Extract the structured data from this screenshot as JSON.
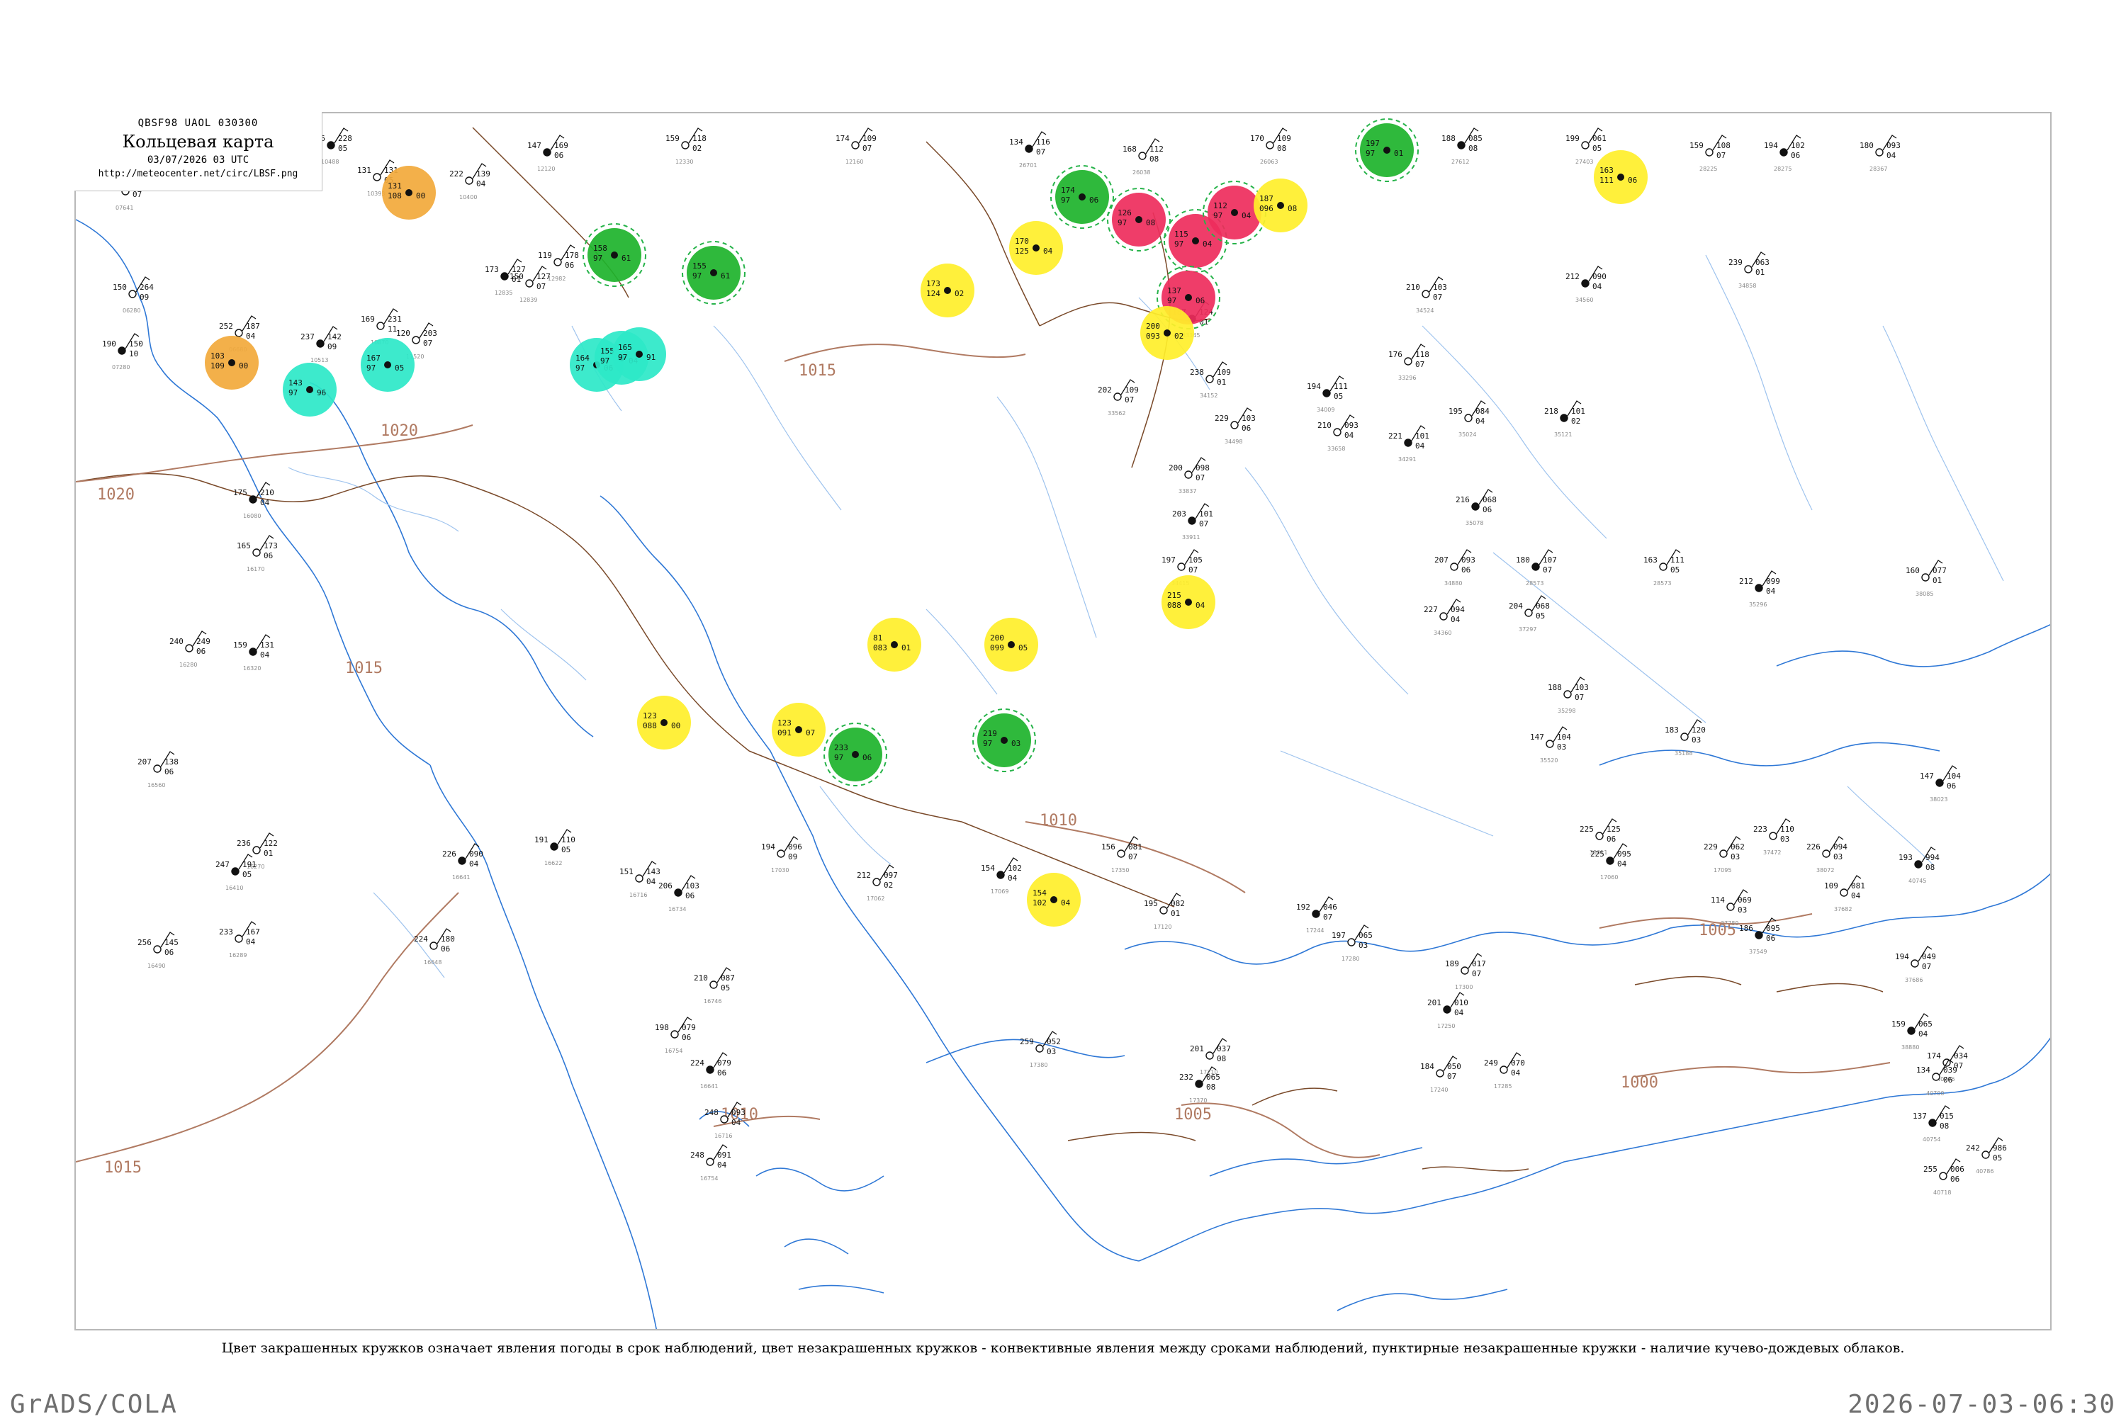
{
  "header": {
    "code": "QBSF98  UAOL  030300",
    "title": "Кольцевая карта",
    "time": "03/07/2026 03 UTC",
    "url": "http://meteocenter.net/circ/LBSF.png"
  },
  "caption": "Цвет закрашенных кружков означает явления погоды в срок наблюдений, цвет незакрашенных кружков - конвективные явления между сроками наблюдений, пунктирные незакрашенные кружки - наличие кучево-дождевых облаков.",
  "footer": {
    "left": "GrADS/COLA",
    "right": "2026-07-03-06:30"
  },
  "isobar_labels": [
    "1020",
    "1015",
    "1015",
    "1010",
    "1005",
    "1020",
    "1015",
    "1010",
    "1005",
    "1000"
  ],
  "colors": {
    "coast": "#2f78d6",
    "river": "#9ec3ee",
    "border": "#7a4a2a",
    "isobar": "#b07a62",
    "thunderstorm_green": "#1db32b",
    "rain_cyan": "#2de8c8",
    "shower_yellow": "#ffef2a",
    "heavy_red": "#ee2c5c",
    "drizzle_orange": "#f2a93b",
    "outline_green": "#27b34a"
  },
  "stations": [
    {
      "t": "126",
      "p": "228",
      "d": "05",
      "id": "10488"
    },
    {
      "t": "131",
      "p": "131",
      "d": "05",
      "id": "10393"
    },
    {
      "t": "222",
      "p": "139",
      "d": "04",
      "id": "10400"
    },
    {
      "t": "147",
      "p": "169",
      "d": "06",
      "id": "12120"
    },
    {
      "t": "159",
      "p": "118",
      "d": "02",
      "id": "12330"
    },
    {
      "t": "174",
      "p": "109",
      "d": "07",
      "id": "12160"
    },
    {
      "t": "134",
      "p": "116",
      "d": "07",
      "id": "26701"
    },
    {
      "t": "168",
      "p": "112",
      "d": "08",
      "id": "26038"
    },
    {
      "t": "170",
      "p": "109",
      "d": "08",
      "id": "26063"
    },
    {
      "t": "188",
      "p": "085",
      "d": "08",
      "id": "27612"
    },
    {
      "t": "199",
      "p": "061",
      "d": "05",
      "id": "27403"
    },
    {
      "t": "159",
      "p": "108",
      "d": "07",
      "id": "28225"
    },
    {
      "t": "194",
      "p": "102",
      "d": "06",
      "id": "28275"
    },
    {
      "t": "180",
      "p": "093",
      "d": "04",
      "id": "28367"
    },
    {
      "t": "273",
      "p": "178",
      "d": "07",
      "id": "07641"
    },
    {
      "t": "190",
      "p": "150",
      "d": "10",
      "id": "07280"
    },
    {
      "t": "150",
      "p": "264",
      "d": "09",
      "id": "06280"
    },
    {
      "t": "252",
      "p": "187",
      "d": "04",
      "id": "06680"
    },
    {
      "t": "237",
      "p": "142",
      "d": "09",
      "id": "10513"
    },
    {
      "t": "169",
      "p": "231",
      "d": "11",
      "id": "10870"
    },
    {
      "t": "120",
      "p": "203",
      "d": "07",
      "id": "11520"
    },
    {
      "t": "173",
      "p": "127",
      "d": "01",
      "id": "12835"
    },
    {
      "t": "119",
      "p": "178",
      "d": "06",
      "id": "12982"
    },
    {
      "t": "150",
      "p": "127",
      "d": "07",
      "id": "12839"
    },
    {
      "t": "175",
      "p": "210",
      "d": "04",
      "id": "16080"
    },
    {
      "t": "165",
      "p": "173",
      "d": "06",
      "id": "16170"
    },
    {
      "t": "240",
      "p": "249",
      "d": "06",
      "id": "16280"
    },
    {
      "t": "159",
      "p": "131",
      "d": "04",
      "id": "16320"
    },
    {
      "t": "207",
      "p": "138",
      "d": "06",
      "id": "16560"
    },
    {
      "t": "236",
      "p": "122",
      "d": "01",
      "id": "16270"
    },
    {
      "t": "247",
      "p": "191",
      "d": "05",
      "id": "16410"
    },
    {
      "t": "233",
      "p": "167",
      "d": "04",
      "id": "16289"
    },
    {
      "t": "256",
      "p": "145",
      "d": "06",
      "id": "16490"
    },
    {
      "t": "226",
      "p": "090",
      "d": "04",
      "id": "16641"
    },
    {
      "t": "224",
      "p": "180",
      "d": "06",
      "id": "16648"
    },
    {
      "t": "151",
      "p": "143",
      "d": "04",
      "id": "16716"
    },
    {
      "t": "206",
      "p": "103",
      "d": "06",
      "id": "16734"
    },
    {
      "t": "210",
      "p": "087",
      "d": "05",
      "id": "16746"
    },
    {
      "t": "198",
      "p": "079",
      "d": "06",
      "id": "16754"
    },
    {
      "t": "224",
      "p": "079",
      "d": "06",
      "id": "16641"
    },
    {
      "t": "248",
      "p": "093",
      "d": "04",
      "id": "16716"
    },
    {
      "t": "248",
      "p": "091",
      "d": "04",
      "id": "16754"
    },
    {
      "t": "191",
      "p": "110",
      "d": "05",
      "id": "16622"
    },
    {
      "t": "194",
      "p": "096",
      "d": "09",
      "id": "17030"
    },
    {
      "t": "212",
      "p": "097",
      "d": "02",
      "id": "17062"
    },
    {
      "t": "154",
      "p": "102",
      "d": "04",
      "id": "17069"
    },
    {
      "t": "156",
      "p": "081",
      "d": "07",
      "id": "17350"
    },
    {
      "t": "195",
      "p": "082",
      "d": "01",
      "id": "17120"
    },
    {
      "t": "192",
      "p": "046",
      "d": "07",
      "id": "17244"
    },
    {
      "t": "197",
      "p": "065",
      "d": "03",
      "id": "17280"
    },
    {
      "t": "189",
      "p": "017",
      "d": "07",
      "id": "17300"
    },
    {
      "t": "201",
      "p": "010",
      "d": "04",
      "id": "17250"
    },
    {
      "t": "184",
      "p": "050",
      "d": "07",
      "id": "17240"
    },
    {
      "t": "259",
      "p": "052",
      "d": "03",
      "id": "17380"
    },
    {
      "t": "232",
      "p": "065",
      "d": "08",
      "id": "17370"
    },
    {
      "t": "201",
      "p": "037",
      "d": "08",
      "id": "17210"
    },
    {
      "t": "249",
      "p": "070",
      "d": "04",
      "id": "17285"
    },
    {
      "t": "225",
      "p": "095",
      "d": "04",
      "id": "17060"
    },
    {
      "t": "229",
      "p": "062",
      "d": "03",
      "id": "17095"
    },
    {
      "t": "114",
      "p": "069",
      "d": "03",
      "id": "37789"
    },
    {
      "t": "186",
      "p": "095",
      "d": "06",
      "id": "37549"
    },
    {
      "t": "109",
      "p": "081",
      "d": "04",
      "id": "37682"
    },
    {
      "t": "194",
      "p": "049",
      "d": "07",
      "id": "37686"
    },
    {
      "t": "159",
      "p": "065",
      "d": "04",
      "id": "38880"
    },
    {
      "t": "174",
      "p": "034",
      "d": "07",
      "id": "40706"
    },
    {
      "t": "134",
      "p": "039",
      "d": "06",
      "id": "40700"
    },
    {
      "t": "137",
      "p": "015",
      "d": "08",
      "id": "40754"
    },
    {
      "t": "255",
      "p": "006",
      "d": "06",
      "id": "40718"
    },
    {
      "t": "242",
      "p": "986",
      "d": "05",
      "id": "40786"
    },
    {
      "t": "193",
      "p": "994",
      "d": "08",
      "id": "40745"
    },
    {
      "t": "223",
      "p": "110",
      "d": "03",
      "id": "37472"
    },
    {
      "t": "226",
      "p": "094",
      "d": "03",
      "id": "38072"
    },
    {
      "t": "147",
      "p": "104",
      "d": "06",
      "id": "38023"
    },
    {
      "t": "160",
      "p": "077",
      "d": "01",
      "id": "38085"
    },
    {
      "t": "204",
      "p": "068",
      "d": "05",
      "id": "37297"
    },
    {
      "t": "216",
      "p": "068",
      "d": "06",
      "id": "35078"
    },
    {
      "t": "207",
      "p": "093",
      "d": "06",
      "id": "34880"
    },
    {
      "t": "227",
      "p": "094",
      "d": "04",
      "id": "34360"
    },
    {
      "t": "221",
      "p": "101",
      "d": "04",
      "id": "34291"
    },
    {
      "t": "229",
      "p": "103",
      "d": "06",
      "id": "34498"
    },
    {
      "t": "238",
      "p": "109",
      "d": "01",
      "id": "34152"
    },
    {
      "t": "194",
      "p": "111",
      "d": "05",
      "id": "34009"
    },
    {
      "t": "210",
      "p": "093",
      "d": "04",
      "id": "33658"
    },
    {
      "t": "200",
      "p": "098",
      "d": "07",
      "id": "33837"
    },
    {
      "t": "203",
      "p": "101",
      "d": "07",
      "id": "33911"
    },
    {
      "t": "197",
      "p": "105",
      "d": "07",
      "id": "34415"
    },
    {
      "t": "202",
      "p": "109",
      "d": "07",
      "id": "33562"
    },
    {
      "t": "187",
      "p": "124",
      "d": "01",
      "id": "33345"
    },
    {
      "t": "176",
      "p": "118",
      "d": "07",
      "id": "33296"
    },
    {
      "t": "210",
      "p": "103",
      "d": "07",
      "id": "34524"
    },
    {
      "t": "212",
      "p": "090",
      "d": "04",
      "id": "34560"
    },
    {
      "t": "239",
      "p": "063",
      "d": "01",
      "id": "34858"
    },
    {
      "t": "195",
      "p": "084",
      "d": "04",
      "id": "35024"
    },
    {
      "t": "218",
      "p": "101",
      "d": "02",
      "id": "35121"
    },
    {
      "t": "183",
      "p": "120",
      "d": "03",
      "id": "35188"
    },
    {
      "t": "188",
      "p": "103",
      "d": "07",
      "id": "35298"
    },
    {
      "t": "212",
      "p": "099",
      "d": "04",
      "id": "35296"
    },
    {
      "t": "147",
      "p": "104",
      "d": "03",
      "id": "35520"
    },
    {
      "t": "163",
      "p": "111",
      "d": "05",
      "id": "28573"
    },
    {
      "t": "180",
      "p": "107",
      "d": "07",
      "id": "28573"
    },
    {
      "t": "225",
      "p": "125",
      "d": "06",
      "id": "35011"
    }
  ],
  "weather_markers": [
    {
      "kind": "drizzle_orange",
      "t": "131",
      "p": "108",
      "d": "00"
    },
    {
      "kind": "drizzle_orange",
      "t": "103",
      "p": "109",
      "d": "00"
    },
    {
      "kind": "rain_cyan",
      "t": "143",
      "p": "97",
      "d": "96"
    },
    {
      "kind": "rain_cyan",
      "t": "167",
      "p": "97",
      "d": "05"
    },
    {
      "kind": "rain_cyan",
      "t": "164",
      "p": "97",
      "d": "06"
    },
    {
      "kind": "rain_cyan",
      "t": "155",
      "p": "97",
      "d": "04"
    },
    {
      "kind": "rain_cyan",
      "t": "165",
      "p": "97",
      "d": "91"
    },
    {
      "kind": "thunderstorm_green",
      "t": "158",
      "p": "97",
      "d": "61"
    },
    {
      "kind": "thunderstorm_green",
      "t": "155",
      "p": "97",
      "d": "61"
    },
    {
      "kind": "thunderstorm_green",
      "t": "174",
      "p": "97",
      "d": "06"
    },
    {
      "kind": "thunderstorm_green",
      "t": "197",
      "p": "97",
      "d": "01"
    },
    {
      "kind": "thunderstorm_green",
      "t": "233",
      "p": "97",
      "d": "06"
    },
    {
      "kind": "thunderstorm_green",
      "t": "219",
      "p": "97",
      "d": "03"
    },
    {
      "kind": "heavy_red",
      "t": "126",
      "p": "97",
      "d": "08"
    },
    {
      "kind": "heavy_red",
      "t": "115",
      "p": "97",
      "d": "04"
    },
    {
      "kind": "heavy_red",
      "t": "112",
      "p": "97",
      "d": "04"
    },
    {
      "kind": "heavy_red",
      "t": "137",
      "p": "97",
      "d": "06"
    },
    {
      "kind": "shower_yellow",
      "t": "170",
      "p": "125",
      "d": "04"
    },
    {
      "kind": "shower_yellow",
      "t": "173",
      "p": "124",
      "d": "02"
    },
    {
      "kind": "shower_yellow",
      "t": "200",
      "p": "093",
      "d": "02"
    },
    {
      "kind": "shower_yellow",
      "t": "187",
      "p": "096",
      "d": "08"
    },
    {
      "kind": "shower_yellow",
      "t": "163",
      "p": "111",
      "d": "06"
    },
    {
      "kind": "shower_yellow",
      "t": "81",
      "p": "083",
      "d": "01"
    },
    {
      "kind": "shower_yellow",
      "t": "123",
      "p": "088",
      "d": "00"
    },
    {
      "kind": "shower_yellow",
      "t": "123",
      "p": "091",
      "d": "07"
    },
    {
      "kind": "shower_yellow",
      "t": "200",
      "p": "099",
      "d": "05"
    },
    {
      "kind": "shower_yellow",
      "t": "215",
      "p": "088",
      "d": "04"
    },
    {
      "kind": "shower_yellow",
      "t": "154",
      "p": "102",
      "d": "04"
    }
  ]
}
